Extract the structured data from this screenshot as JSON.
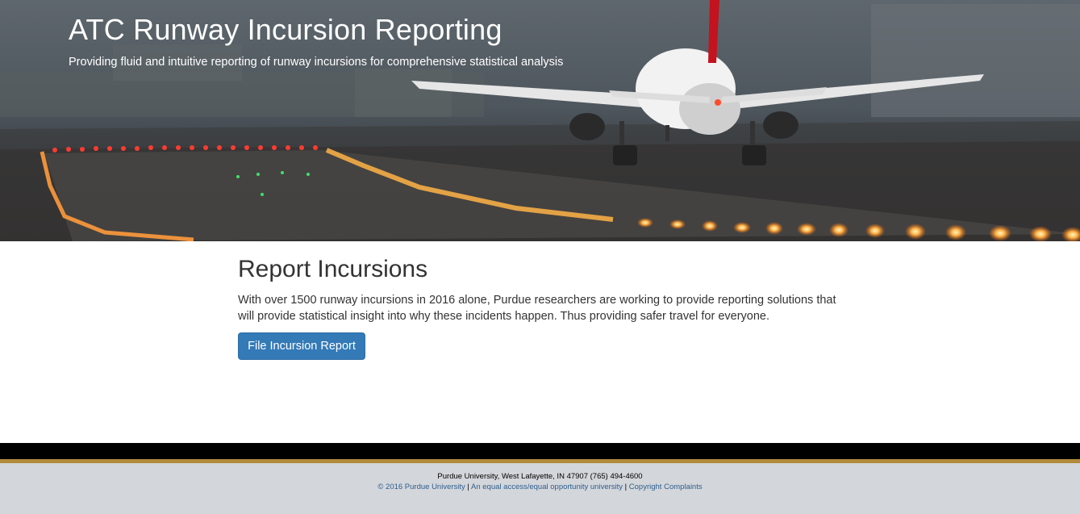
{
  "header": {
    "title": "ATC Runway Incursion Reporting",
    "subtitle": "Providing fluid and intuitive reporting of runway incursions for comprehensive statistical analysis"
  },
  "main": {
    "heading": "Report Incursions",
    "description": "With over 1500 runway incursions in 2016 alone, Purdue researchers are working to provide reporting solutions that will provide statistical insight into why these incidents happen. Thus providing safer travel for everyone.",
    "button_label": "File Incursion Report"
  },
  "footer": {
    "address": "Purdue University, West Lafayette, IN 47907 (765) 494-4600",
    "copyright_link": "© 2016 Purdue University",
    "separator": "|",
    "equal_access_link": "An equal access/equal opportunity university",
    "complaints_link": "Copyright Complaints"
  },
  "colors": {
    "primary_button": "#337ab7",
    "footer_gold": "#b18a3c",
    "footer_bg": "#d3d6da"
  }
}
